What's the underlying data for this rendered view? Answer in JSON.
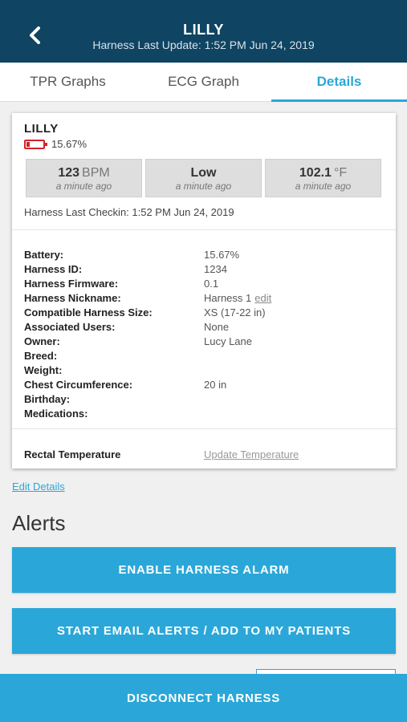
{
  "header": {
    "title": "LILLY",
    "subtitle": "Harness Last Update: 1:52 PM Jun 24, 2019",
    "back_icon": "chevron-left-icon",
    "background": "#0f4462"
  },
  "tabs": [
    {
      "label": "TPR Graphs",
      "active": false
    },
    {
      "label": "ECG Graph",
      "active": false
    },
    {
      "label": "Details",
      "active": true
    }
  ],
  "card": {
    "pet_name": "LILLY",
    "battery_icon": "battery-low-icon",
    "battery_percent": "15.67%",
    "vitals": [
      {
        "value": "123",
        "unit": "BPM",
        "time": "a minute ago"
      },
      {
        "value": "Low",
        "unit": "",
        "time": "a minute ago"
      },
      {
        "value": "102.1",
        "unit": "°F",
        "time": "a minute ago"
      }
    ],
    "checkin": "Harness Last Checkin: 1:52 PM Jun 24, 2019",
    "details": [
      {
        "label": "Battery:",
        "value": "15.67%"
      },
      {
        "label": "Harness ID:",
        "value": "1234"
      },
      {
        "label": "Harness Firmware:",
        "value": "0.1"
      },
      {
        "label": "Harness Nickname:",
        "value": "Harness 1",
        "link": "edit"
      },
      {
        "label": "Compatible Harness Size:",
        "value": "XS (17-22 in)"
      },
      {
        "label": "Associated Users:",
        "value": "None"
      },
      {
        "label": "Owner:",
        "value": "Lucy Lane"
      },
      {
        "label": "Breed:",
        "value": ""
      },
      {
        "label": "Weight:",
        "value": ""
      },
      {
        "label": "Chest Circumference:",
        "value": "20 in"
      },
      {
        "label": "Birthday:",
        "value": ""
      },
      {
        "label": "Medications:",
        "value": ""
      }
    ],
    "rectal_label": "Rectal Temperature",
    "rectal_link": "Update Temperature"
  },
  "edit_details": "Edit Details",
  "alerts": {
    "heading": "Alerts",
    "enable_alarm": "ENABLE HARNESS ALARM",
    "email_alerts": "START EMAIL ALERTS / ADD TO MY PATIENTS"
  },
  "disconnect": "DISCONNECT HARNESS",
  "colors": {
    "accent": "#2aa7d8",
    "battery_low": "#d2232a"
  }
}
